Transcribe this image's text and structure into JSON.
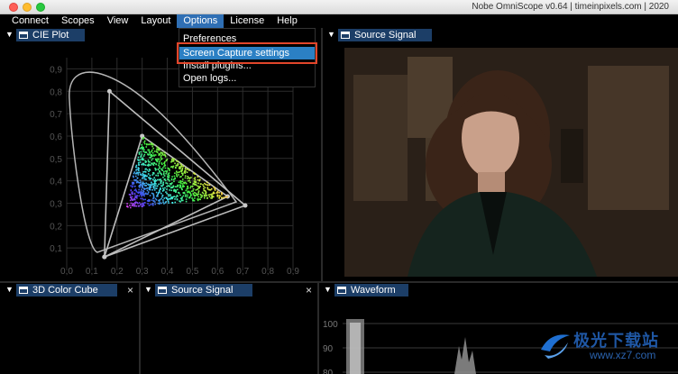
{
  "window": {
    "title": "Nobe OmniScope v0.64 | timeinpixels.com | 2020"
  },
  "menubar": {
    "items": [
      "Connect",
      "Scopes",
      "View",
      "Layout",
      "Options",
      "License",
      "Help"
    ]
  },
  "options_menu": {
    "items": [
      "Preferences",
      "Screen Capture settings",
      "Install plugins...",
      "Open logs..."
    ],
    "selected": "Screen Capture settings"
  },
  "panels": {
    "cie": {
      "title": "CIE Plot"
    },
    "source_top": {
      "title": "Source Signal"
    },
    "color_cube": {
      "title": "3D Color Cube",
      "close": "×"
    },
    "source_bottom": {
      "title": "Source Signal",
      "close": "×"
    },
    "waveform": {
      "title": "Waveform"
    }
  },
  "chart_data": [
    {
      "type": "scatter",
      "name_hint": "CIE plot",
      "x_ticks": [
        "0,0",
        "0,1",
        "0,2",
        "0,3",
        "0,4",
        "0,5",
        "0,6",
        "0,7",
        "0,8",
        "0,9"
      ],
      "y_ticks": [
        "0,9",
        "0,8",
        "0,7",
        "0,6",
        "0,5",
        "0,4",
        "0,3",
        "0,2",
        "0,1"
      ],
      "xlim": [
        0,
        0.9
      ],
      "ylim": [
        0,
        0.95
      ],
      "gamut_outer": [
        [
          0.17,
          0.8
        ],
        [
          0.71,
          0.29
        ],
        [
          0.15,
          0.06
        ]
      ],
      "gamut_inner": [
        [
          0.3,
          0.6
        ],
        [
          0.64,
          0.33
        ],
        [
          0.15,
          0.06
        ]
      ],
      "grid": true
    },
    {
      "type": "area",
      "name_hint": "waveform",
      "y_ticks": [
        "100",
        "90",
        "80"
      ]
    }
  ],
  "colors": {
    "menu_highlight": "#2b80c4",
    "tab_background": "#1c3e67",
    "callout_border": "#e2452a"
  },
  "watermark": {
    "line1": "极光下载站",
    "line2": "www.xz7.com"
  }
}
